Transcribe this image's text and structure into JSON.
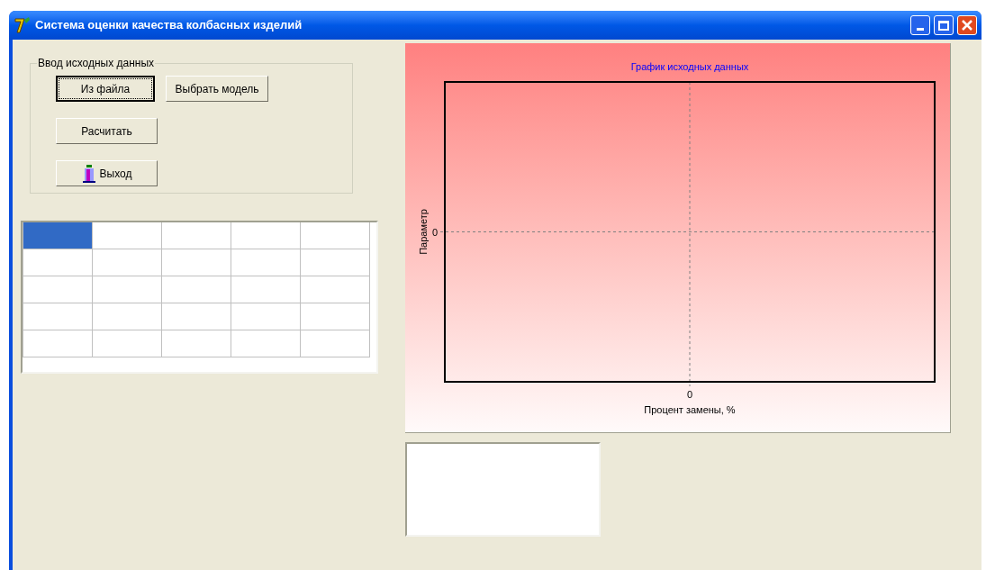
{
  "window": {
    "title": "Система оценки качества колбасных изделий"
  },
  "input_group": {
    "title": "Ввод исходных данных",
    "buttons": [
      {
        "label": "Из файла",
        "focused": true,
        "kind": "text"
      },
      {
        "label": "Выбрать модель",
        "focused": false,
        "kind": "text"
      },
      {
        "label": "Расчитать",
        "focused": false,
        "kind": "text"
      },
      {
        "label": "Выход",
        "focused": false,
        "kind": "exit"
      }
    ]
  },
  "grid": {
    "rows": [
      {
        "cells": [
          {
            "selected": true
          },
          {
            "selected": false
          },
          {
            "selected": false
          },
          {
            "selected": false
          },
          {
            "selected": false
          }
        ]
      },
      {
        "cells": [
          {
            "selected": false
          },
          {
            "selected": false
          },
          {
            "selected": false
          },
          {
            "selected": false
          },
          {
            "selected": false
          }
        ]
      },
      {
        "cells": [
          {
            "selected": false
          },
          {
            "selected": false
          },
          {
            "selected": false
          },
          {
            "selected": false
          },
          {
            "selected": false
          }
        ]
      },
      {
        "cells": [
          {
            "selected": false
          },
          {
            "selected": false
          },
          {
            "selected": false
          },
          {
            "selected": false
          },
          {
            "selected": false
          }
        ]
      },
      {
        "cells": [
          {
            "selected": false
          },
          {
            "selected": false
          },
          {
            "selected": false
          },
          {
            "selected": false
          },
          {
            "selected": false
          }
        ]
      }
    ]
  },
  "chart": {
    "title": "График исходных данных",
    "xlabel": "Процент замены, %",
    "ylabel": "Параметр",
    "x_tick": "0",
    "y_tick": "0"
  }
}
